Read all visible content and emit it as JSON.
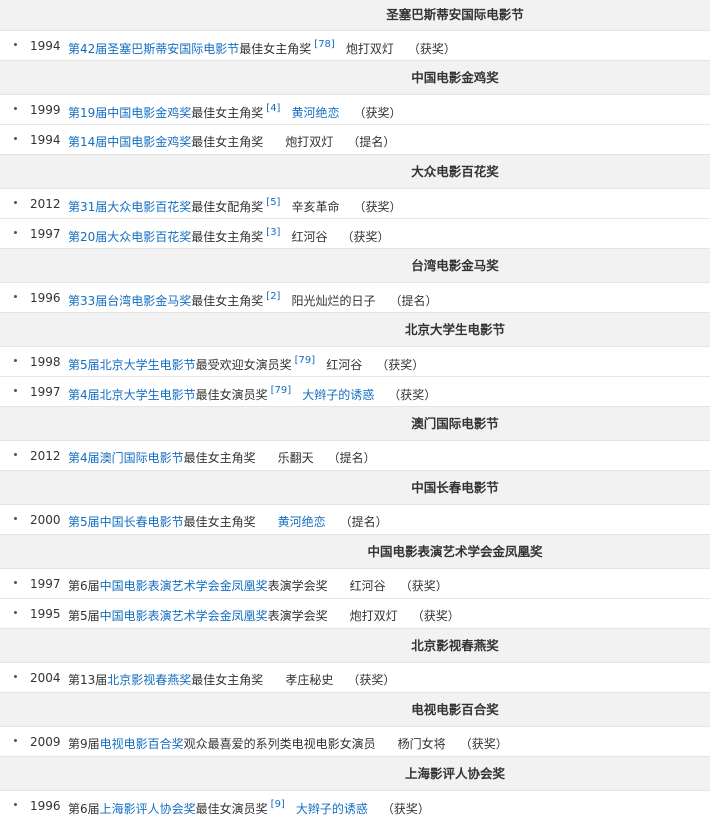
{
  "sections": [
    {
      "title": "圣塞巴斯蒂安国际电影节",
      "height": 30,
      "rows": [
        {
          "year": "1994",
          "parts": [
            {
              "t": "第42届圣塞巴斯蒂安国际电影节",
              "link": true
            },
            {
              "t": "最佳女主角奖"
            }
          ],
          "ref": "[78]",
          "work": "炮打双灯",
          "work_link": false,
          "result": "（获奖）"
        }
      ]
    },
    {
      "title": "中国电影金鸡奖",
      "height": 33,
      "rows": [
        {
          "year": "1999",
          "parts": [
            {
              "t": "第19届中国电影金鸡奖",
              "link": true
            },
            {
              "t": "最佳女主角奖"
            }
          ],
          "ref": "[4]",
          "work": "黄河绝恋",
          "work_link": true,
          "result": "（获奖）"
        },
        {
          "year": "1994",
          "parts": [
            {
              "t": "第14届中国电影金鸡奖",
              "link": true
            },
            {
              "t": "最佳女主角奖"
            }
          ],
          "ref": "",
          "work": "炮打双灯",
          "work_link": false,
          "result": "（提名）"
        }
      ]
    },
    {
      "title": "大众电影百花奖",
      "height": 33,
      "rows": [
        {
          "year": "2012",
          "parts": [
            {
              "t": "第31届大众电影百花奖",
              "link": true
            },
            {
              "t": "最佳女配角奖"
            }
          ],
          "ref": "[5]",
          "work": "辛亥革命",
          "work_link": false,
          "result": "（获奖）"
        },
        {
          "year": "1997",
          "parts": [
            {
              "t": "第20届大众电影百花奖",
              "link": true
            },
            {
              "t": "最佳女主角奖"
            }
          ],
          "ref": "[3]",
          "work": "红河谷",
          "work_link": false,
          "result": "（获奖）"
        }
      ]
    },
    {
      "title": "台湾电影金马奖",
      "height": 33,
      "rows": [
        {
          "year": "1996",
          "parts": [
            {
              "t": "第33届台湾电影金马奖",
              "link": true
            },
            {
              "t": "最佳女主角奖"
            }
          ],
          "ref": "[2]",
          "work": "阳光灿烂的日子",
          "work_link": false,
          "result": "（提名）"
        }
      ]
    },
    {
      "title": "北京大学生电影节",
      "height": 33,
      "rows": [
        {
          "year": "1998",
          "parts": [
            {
              "t": "第5届北京大学生电影节",
              "link": true
            },
            {
              "t": "最受欢迎女演员奖"
            }
          ],
          "ref": "[79]",
          "work": "红河谷",
          "work_link": false,
          "result": "（获奖）"
        },
        {
          "year": "1997",
          "parts": [
            {
              "t": "第4届北京大学生电影节",
              "link": true
            },
            {
              "t": "最佳女演员奖"
            }
          ],
          "ref": "[79]",
          "work": "大辫子的诱惑",
          "work_link": true,
          "result": "（获奖）"
        }
      ]
    },
    {
      "title": "澳门国际电影节",
      "height": 33,
      "rows": [
        {
          "year": "2012",
          "parts": [
            {
              "t": "第4届澳门国际电影节",
              "link": true
            },
            {
              "t": "最佳女主角奖"
            }
          ],
          "ref": "",
          "work": "乐翻天",
          "work_link": false,
          "result": "（提名）"
        }
      ]
    },
    {
      "title": "中国长春电影节",
      "height": 33,
      "rows": [
        {
          "year": "2000",
          "parts": [
            {
              "t": "第5届中国长春电影节",
              "link": true
            },
            {
              "t": "最佳女主角奖"
            }
          ],
          "ref": "",
          "work": "黄河绝恋",
          "work_link": true,
          "result": "（提名）"
        }
      ]
    },
    {
      "title": "中国电影表演艺术学会金凤凰奖",
      "height": 33,
      "rows": [
        {
          "year": "1997",
          "parts": [
            {
              "t": "第6届"
            },
            {
              "t": "中国电影表演艺术学会金凤凰奖",
              "link": true
            },
            {
              "t": "表演学会奖"
            }
          ],
          "ref": "",
          "work": "红河谷",
          "work_link": false,
          "result": "（获奖）"
        },
        {
          "year": "1995",
          "parts": [
            {
              "t": "第5届"
            },
            {
              "t": "中国电影表演艺术学会金凤凰奖",
              "link": true
            },
            {
              "t": "表演学会奖"
            }
          ],
          "ref": "",
          "work": "炮打双灯",
          "work_link": false,
          "result": "（获奖）"
        }
      ]
    },
    {
      "title": "北京影视春燕奖",
      "height": 33,
      "rows": [
        {
          "year": "2004",
          "parts": [
            {
              "t": "第13届"
            },
            {
              "t": "北京影视春燕奖",
              "link": true
            },
            {
              "t": "最佳女主角奖"
            }
          ],
          "ref": "",
          "work": "孝庄秘史",
          "work_link": false,
          "result": "（获奖）"
        }
      ]
    },
    {
      "title": "电视电影百合奖",
      "height": 33,
      "rows": [
        {
          "year": "2009",
          "parts": [
            {
              "t": "第9届"
            },
            {
              "t": "电视电影百合奖",
              "link": true
            },
            {
              "t": "观众最喜爱的系列类电视电影女演员"
            }
          ],
          "ref": "",
          "work": "杨门女将",
          "work_link": false,
          "result": "（获奖）"
        }
      ]
    },
    {
      "title": "上海影评人协会奖",
      "height": 33,
      "rows": [
        {
          "year": "1996",
          "parts": [
            {
              "t": "第6届"
            },
            {
              "t": "上海影评人协会奖",
              "link": true
            },
            {
              "t": "最佳女演员奖"
            }
          ],
          "ref": "[9]",
          "work": "大辫子的诱惑",
          "work_link": true,
          "result": "（获奖）"
        }
      ]
    }
  ]
}
